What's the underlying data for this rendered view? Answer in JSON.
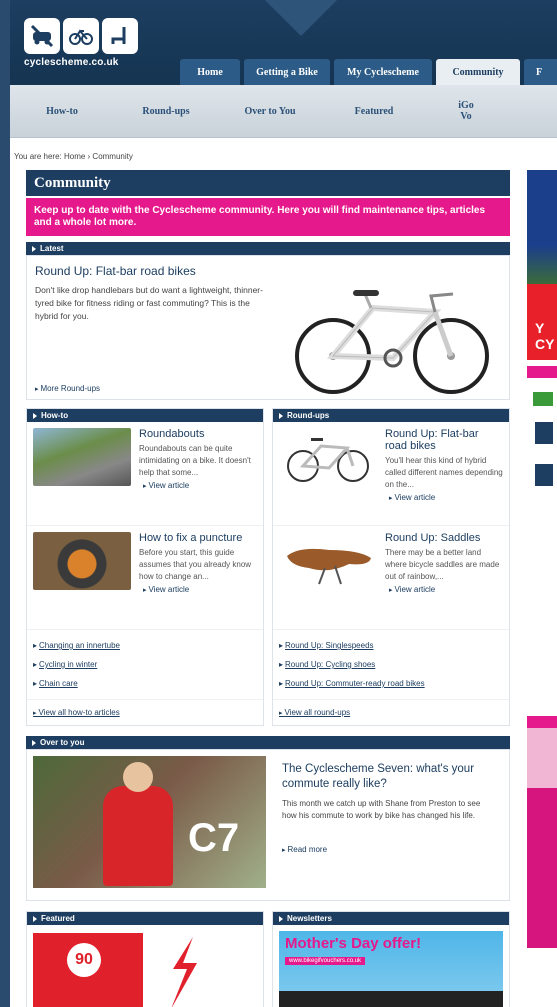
{
  "site": {
    "logo_text": "cyclescheme.co.uk"
  },
  "tabs": [
    "Home",
    "Getting a Bike",
    "My Cyclescheme",
    "Community",
    "F"
  ],
  "subnav": [
    "How-to",
    "Round-ups",
    "Over to You",
    "Featured",
    "iGo\nVo"
  ],
  "breadcrumb": "You are here: Home › Community",
  "community": {
    "title": "Community",
    "intro": "Keep up to date with the Cyclescheme community. Here you will find maintenance tips, articles and a whole lot more."
  },
  "latest": {
    "label": "Latest",
    "title": "Round Up: Flat-bar road bikes",
    "desc": "Don't like drop handlebars but do want a lightweight, thinner-tyred bike for fitness riding or fast commuting? This is the hybrid for you.",
    "more": "More Round-ups"
  },
  "howto": {
    "label": "How-to",
    "items": [
      {
        "title": "Roundabouts",
        "desc": "Roundabouts can be quite intimidating on a bike. It doesn't help that some...",
        "link": "View article"
      },
      {
        "title": "How to fix a puncture",
        "desc": "Before you start, this guide assumes that you already know how to change an...",
        "link": "View article"
      }
    ],
    "links": [
      "Changing an innertube",
      "Cycling in winter",
      "Chain care"
    ],
    "all": "View all how-to articles"
  },
  "roundups": {
    "label": "Round-ups",
    "items": [
      {
        "title": "Round Up: Flat-bar road bikes",
        "desc": "You'll hear this kind of hybrid called different names depending on the...",
        "link": "View article"
      },
      {
        "title": "Round Up: Saddles",
        "desc": "There may be a better land where bicycle saddles are made out of rainbow,...",
        "link": "View article"
      }
    ],
    "links": [
      "Round Up: Singlespeeds",
      "Round Up: Cycling shoes",
      "Round Up: Commuter-ready road bikes"
    ],
    "all": "View all round-ups"
  },
  "over": {
    "label": "Over to you",
    "title": "The Cyclescheme Seven: what's your commute really like?",
    "desc": "This month we catch up with Shane from Preston to see how his commute to work by bike has changed his life.",
    "more": "Read more",
    "badge": "C7"
  },
  "featured": {
    "label": "Featured",
    "badge": "90"
  },
  "newsletters": {
    "label": "Newsletters",
    "offer": "Mother's Day offer!",
    "url": "www.bikegifvouchers.co.uk"
  },
  "side": {
    "y": "Y",
    "cy": "CY"
  }
}
